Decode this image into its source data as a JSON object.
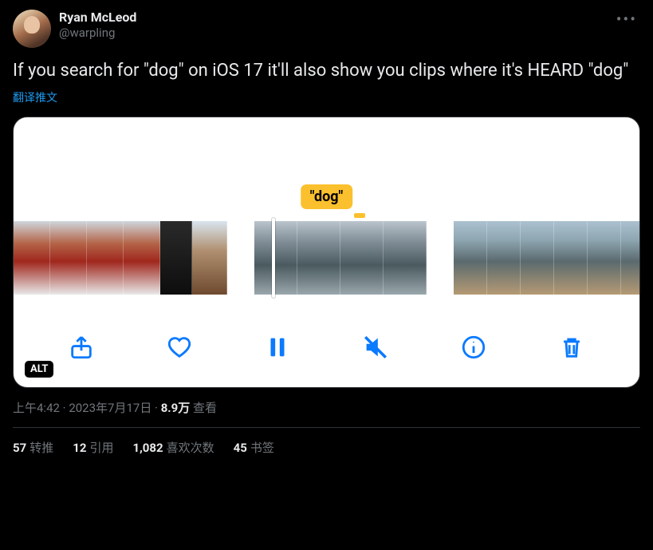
{
  "author": {
    "name": "Ryan McLeod",
    "handle": "@warpling"
  },
  "tweet_text": "If you search for \"dog\" on iOS 17 it'll also show you clips where it's HEARD \"dog\"",
  "translate_label": "翻译推文",
  "media": {
    "search_chip": "\"dog\"",
    "alt_badge": "ALT",
    "toolbar_icons": [
      "share-icon",
      "heart-icon",
      "pause-icon",
      "mute-icon",
      "info-icon",
      "trash-icon"
    ]
  },
  "meta": {
    "time": "上午4:42",
    "date": "2023年7月17日",
    "views_count": "8.9万",
    "views_label": "查看",
    "separator": " · "
  },
  "stats": {
    "retweets_count": "57",
    "retweets_label": "转推",
    "quotes_count": "12",
    "quotes_label": "引用",
    "likes_count": "1,082",
    "likes_label": "喜欢次数",
    "bookmarks_count": "45",
    "bookmarks_label": "书签"
  }
}
